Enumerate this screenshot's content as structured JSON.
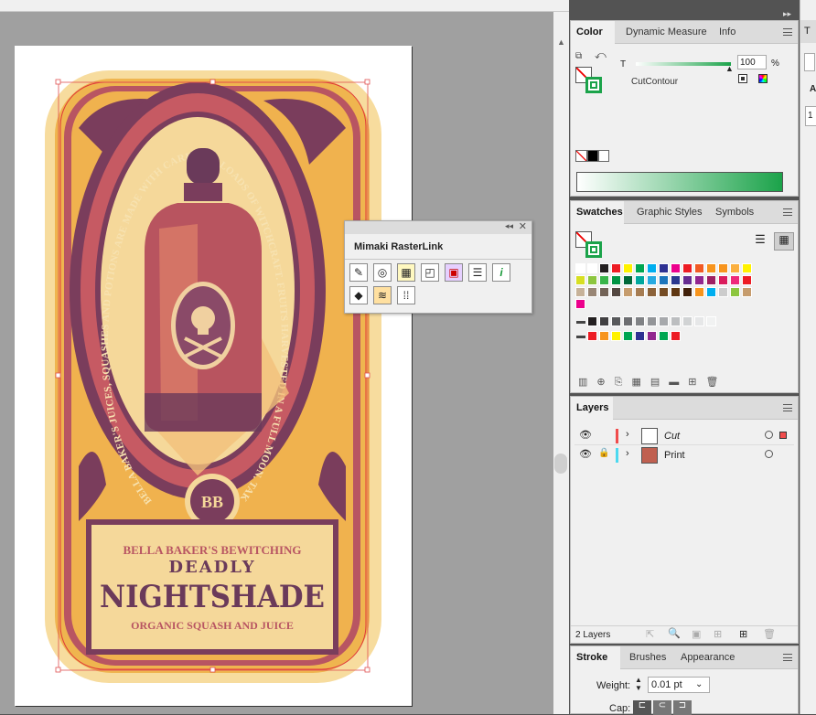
{
  "color_panel": {
    "tabs": [
      "Color",
      "Dynamic Measure",
      "Info"
    ],
    "t_label": "T",
    "t_value": "100",
    "t_unit": "%",
    "swatch_name": "CutContour",
    "tint_level": 0.98
  },
  "swatches_panel": {
    "tabs": [
      "Swatches",
      "Graphic Styles",
      "Symbols"
    ],
    "row1": [
      "#ffffff",
      "#ffffff",
      "#231f20",
      "#ed1c24",
      "#fff200",
      "#00a651",
      "#00aeef",
      "#2e3192",
      "#ec008c",
      "#ed1c24",
      "#f15a24",
      "#f7941d",
      "#f7941d",
      "#fbb040",
      "#fff200"
    ],
    "row2": [
      "#d7df23",
      "#8dc63f",
      "#39b54a",
      "#009444",
      "#006838",
      "#00a79d",
      "#27aae1",
      "#1c75bc",
      "#2b388f",
      "#662d91",
      "#92278f",
      "#9e1f63",
      "#da1c5c",
      "#ee2a7b",
      "#ed1c24"
    ],
    "row3": [
      "#c7b299",
      "#998675",
      "#736357",
      "#534741",
      "#c69c6d",
      "#a67c52",
      "#8c6239",
      "#754c24",
      "#603813",
      "#42210b",
      "#f7941d",
      "#00aeef",
      "#cccccc",
      "#8dc63f",
      "#c69c6d"
    ],
    "row4": [
      "#ec008c"
    ],
    "gray_row": [
      "#231f20",
      "#414042",
      "#58595b",
      "#6d6e71",
      "#808285",
      "#939598",
      "#a7a9ac",
      "#bcbec0",
      "#d1d3d4",
      "#e6e7e8",
      "#f1f2f2"
    ],
    "color_row": [
      "#ed1c24",
      "#f7941d",
      "#fff200",
      "#00a651",
      "#2e3192",
      "#92278f",
      "#00a651",
      "#ed1c24"
    ]
  },
  "layers_panel": {
    "tabs": [
      "Layers"
    ],
    "layers": [
      {
        "name": "Cut",
        "color": "#f04c4c"
      },
      {
        "name": "Print",
        "color": "#4cd9f0"
      }
    ],
    "footer_count": "2 Layers"
  },
  "stroke_panel": {
    "tabs": [
      "Stroke",
      "Brushes",
      "Appearance"
    ],
    "weight_label": "Weight:",
    "weight_value": "0.01 pt",
    "cap_label": "Cap:"
  },
  "mimaki_panel": {
    "title": "Mimaki RasterLink"
  },
  "right_strip": {
    "tab": "T",
    "label": "A",
    "value": "1"
  },
  "artwork": {
    "arc_text": "BELLA BAKER'S JUICES, SQUASHES AND POTIONS ARE MADE WITH CARE AND LOADS OF WITCHCRAFT. FRUITS HARVESTED IN A FULL MOON. TAKE CARE!",
    "monogram": "BB",
    "subtitle": "BELLA BAKER'S BEWITCHING",
    "title_top": "DEADLY",
    "title_main": "NIGHTSHADE",
    "tagline": "ORGANIC SQUASH AND JUICE"
  }
}
